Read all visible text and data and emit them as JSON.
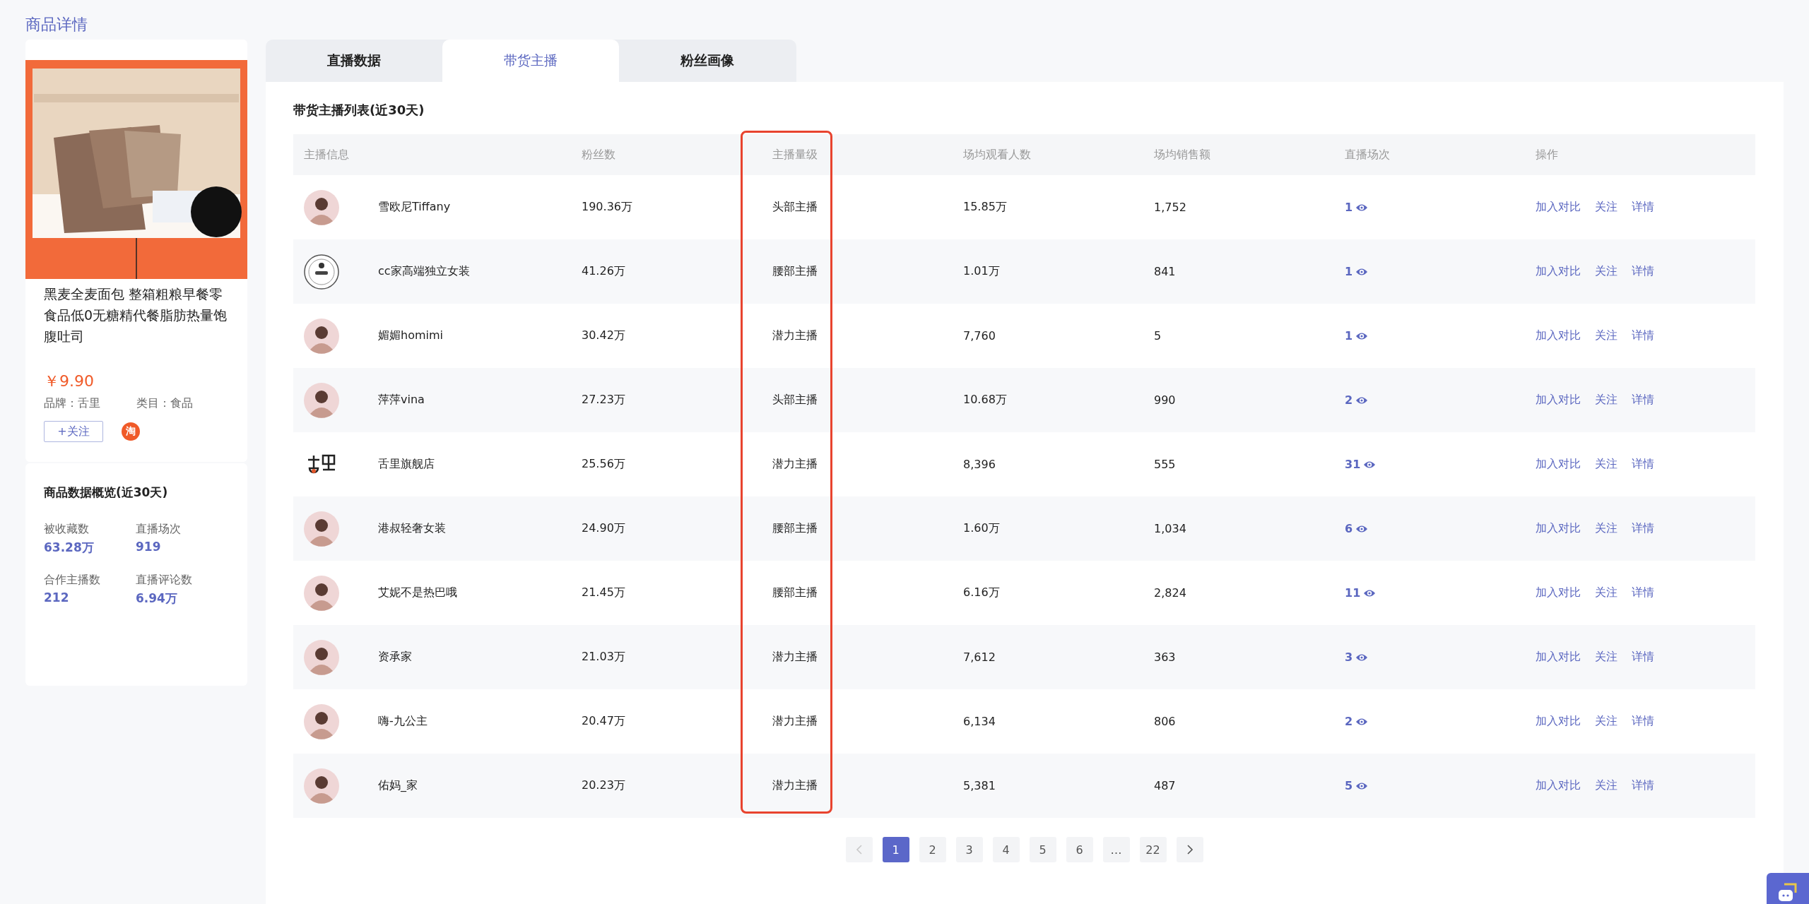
{
  "page_title": "商品详情",
  "product": {
    "title": "黑麦全麦面包 整箱粗粮早餐零食品低0无糖精代餐脂肪热量饱腹吐司",
    "price": "￥9.90",
    "brand": "品牌：舌里",
    "category": "类目：食品",
    "follow_button": "+关注",
    "platform_badge": "淘"
  },
  "overview": {
    "title": "商品数据概览(近30天)",
    "stats": [
      {
        "label": "被收藏数",
        "value": "63.28万"
      },
      {
        "label": "直播场次",
        "value": "919"
      },
      {
        "label": "合作主播数",
        "value": "212"
      },
      {
        "label": "直播评论数",
        "value": "6.94万"
      }
    ]
  },
  "tabs": [
    {
      "label": "直播数据",
      "selected": false
    },
    {
      "label": "带货主播",
      "selected": true
    },
    {
      "label": "粉丝画像",
      "selected": false
    }
  ],
  "section_title": "带货主播列表(近30天)",
  "table": {
    "columns": [
      {
        "label": "主播信息",
        "highlighted": false
      },
      {
        "label": "粉丝数",
        "highlighted": false
      },
      {
        "label": "主播量级",
        "highlighted": true
      },
      {
        "label": "场均观看人数",
        "highlighted": false
      },
      {
        "label": "场均销售额",
        "highlighted": false
      },
      {
        "label": "直播场次",
        "highlighted": false
      },
      {
        "label": "操作",
        "highlighted": false
      }
    ],
    "rows": [
      {
        "name": "雪欧尼Tiffany",
        "fans": "190.36万",
        "tier": "头部主播",
        "avg_viewers": "15.85万",
        "avg_sales": "1,752",
        "sessions": "1",
        "actions": [
          "加入对比",
          "关注",
          "详情"
        ]
      },
      {
        "kind": "badge",
        "name": "cc家高端独立女装",
        "fans": "41.26万",
        "tier": "腰部主播",
        "avg_viewers": "1.01万",
        "avg_sales": "841",
        "sessions": "1",
        "actions": [
          "加入对比",
          "关注",
          "详情"
        ]
      },
      {
        "name": "媚媚homimi",
        "fans": "30.42万",
        "tier": "潜力主播",
        "avg_viewers": "7,760",
        "avg_sales": "5",
        "sessions": "1",
        "actions": [
          "加入对比",
          "关注",
          "详情"
        ]
      },
      {
        "name": "萍萍vina",
        "fans": "27.23万",
        "tier": "头部主播",
        "avg_viewers": "10.68万",
        "avg_sales": "990",
        "sessions": "2",
        "actions": [
          "加入对比",
          "关注",
          "详情"
        ]
      },
      {
        "kind": "logo",
        "name": "舌里旗舰店",
        "fans": "25.56万",
        "tier": "潜力主播",
        "avg_viewers": "8,396",
        "avg_sales": "555",
        "sessions": "31",
        "actions": [
          "加入对比",
          "关注",
          "详情"
        ]
      },
      {
        "name": "港叔轻奢女装",
        "fans": "24.90万",
        "tier": "腰部主播",
        "avg_viewers": "1.60万",
        "avg_sales": "1,034",
        "sessions": "6",
        "actions": [
          "加入对比",
          "关注",
          "详情"
        ]
      },
      {
        "name": "艾妮不是热巴哦",
        "fans": "21.45万",
        "tier": "腰部主播",
        "avg_viewers": "6.16万",
        "avg_sales": "2,824",
        "sessions": "11",
        "actions": [
          "加入对比",
          "关注",
          "详情"
        ]
      },
      {
        "name": "资承家",
        "fans": "21.03万",
        "tier": "潜力主播",
        "avg_viewers": "7,612",
        "avg_sales": "363",
        "sessions": "3",
        "actions": [
          "加入对比",
          "关注",
          "详情"
        ]
      },
      {
        "name": "嗨-九公主",
        "fans": "20.47万",
        "tier": "潜力主播",
        "avg_viewers": "6,134",
        "avg_sales": "806",
        "sessions": "2",
        "actions": [
          "加入对比",
          "关注",
          "详情"
        ]
      },
      {
        "name": "佑妈_家",
        "fans": "20.23万",
        "tier": "潜力主播",
        "avg_viewers": "5,381",
        "avg_sales": "487",
        "sessions": "5",
        "actions": [
          "加入对比",
          "关注",
          "详情"
        ]
      }
    ]
  },
  "pagination": {
    "prev_disabled": true,
    "pages": [
      {
        "label": "1",
        "selected": true
      },
      {
        "label": "2",
        "selected": false
      },
      {
        "label": "3",
        "selected": false
      },
      {
        "label": "4",
        "selected": false
      },
      {
        "label": "5",
        "selected": false
      },
      {
        "label": "6",
        "selected": false
      },
      {
        "label": "…",
        "selected": false
      },
      {
        "label": "22",
        "selected": false
      }
    ]
  }
}
